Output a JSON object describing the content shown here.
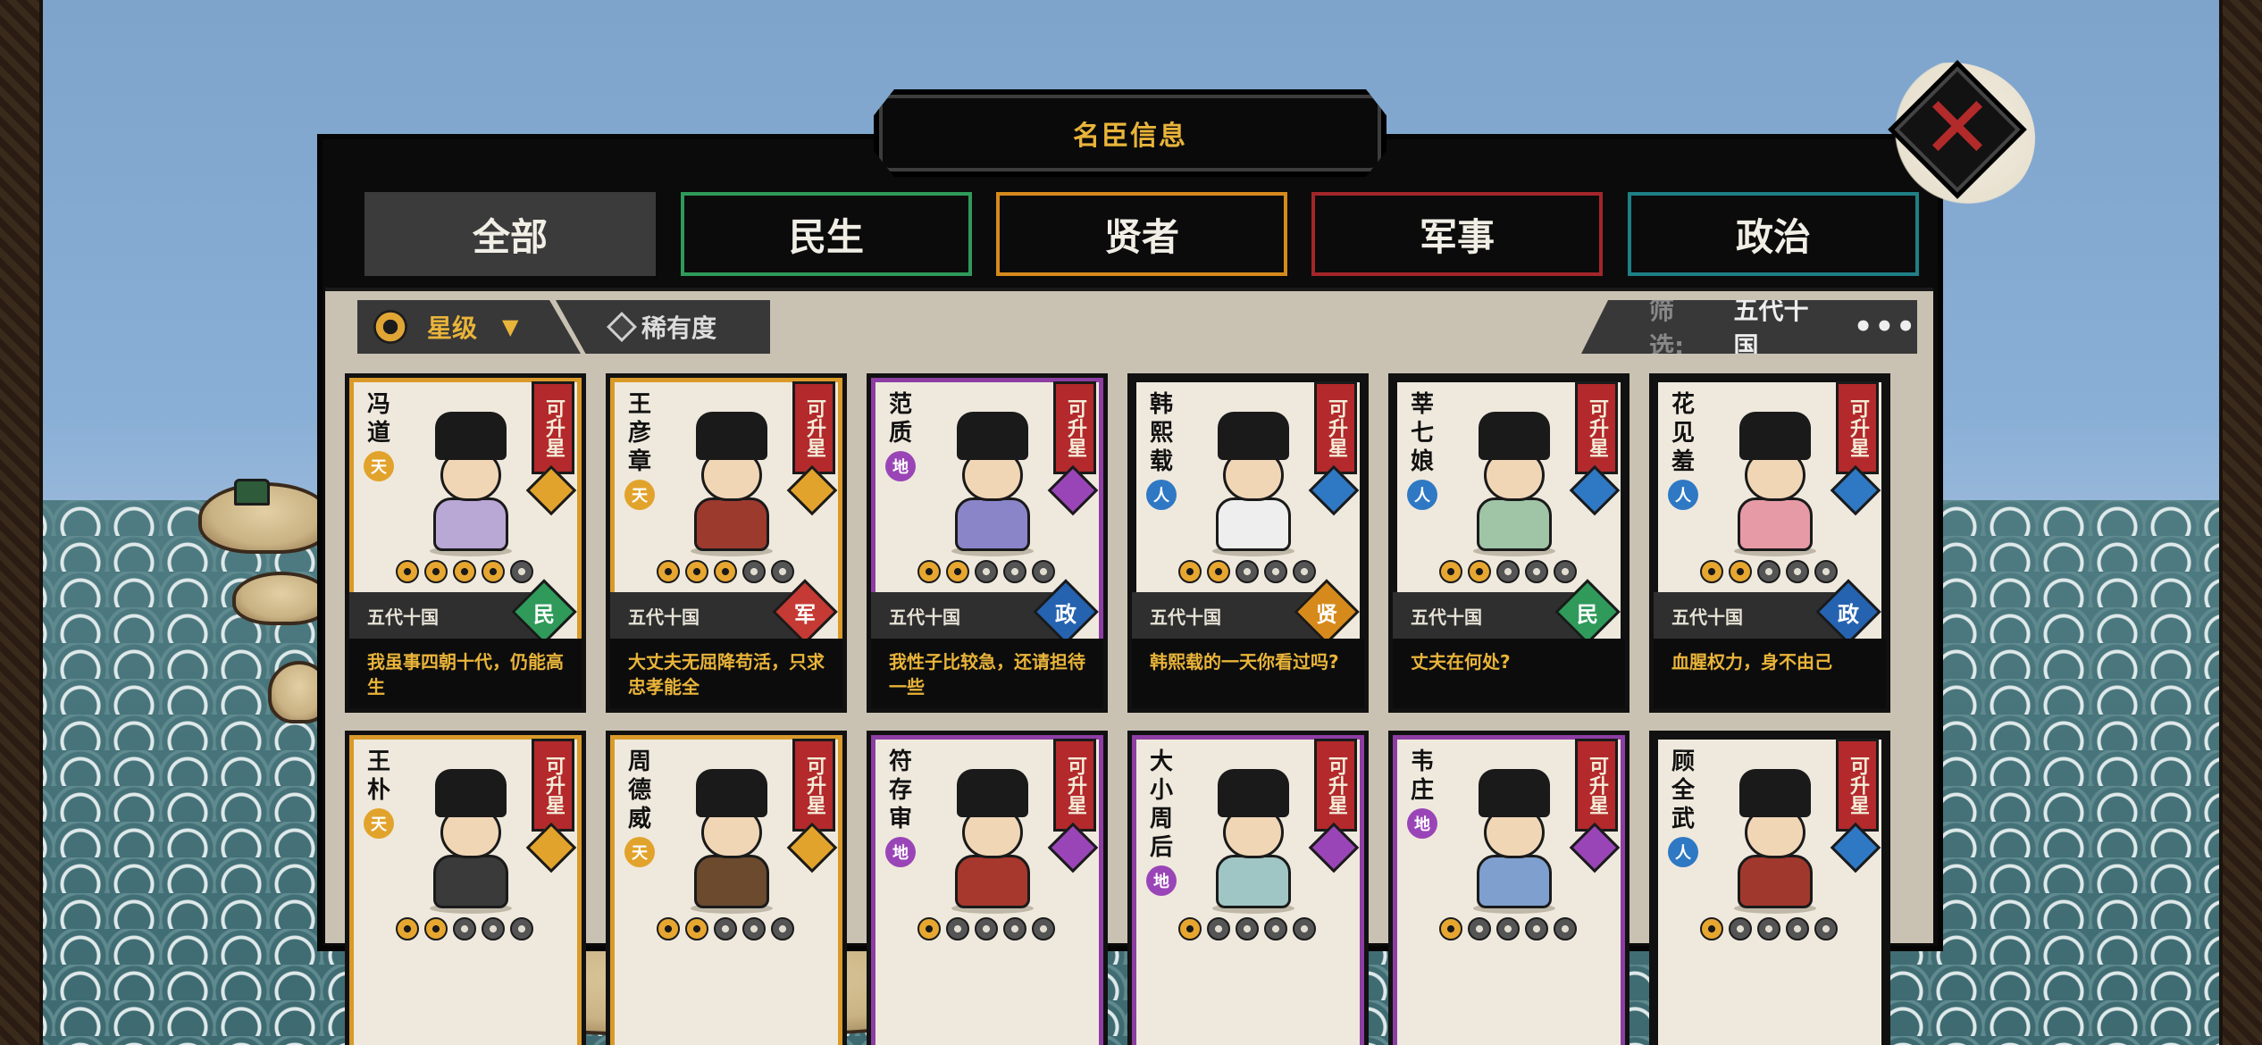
{
  "panel": {
    "title": "名臣信息"
  },
  "tabs": [
    {
      "label": "全部",
      "color": "#3b3b3b"
    },
    {
      "label": "民生",
      "color": "#2f9a5a"
    },
    {
      "label": "贤者",
      "color": "#d68a1c"
    },
    {
      "label": "军事",
      "color": "#a3262a"
    },
    {
      "label": "政治",
      "color": "#1f7f86"
    }
  ],
  "filters": {
    "star_label": "星级",
    "rarity_label": "稀有度",
    "filter_label": "筛选:",
    "filter_value": "五代十国",
    "more": "•••"
  },
  "rank_colors": {
    "天": "#e2a32c",
    "地": "#9a45b7",
    "人": "#2f78c4"
  },
  "type_colors": {
    "民": "#2f9a5a",
    "军": "#c53a34",
    "政": "#2563b0",
    "贤": "#d68a1c"
  },
  "cards": [
    {
      "name": "冯道",
      "rank": "天",
      "frame": "gold",
      "stars": 4,
      "upgrade": "可升星",
      "dynasty": "五代十国",
      "type": "民",
      "quote": "我虽事四朝十代，仍能高生",
      "body_color": "#b9a7d6"
    },
    {
      "name": "王彦章",
      "rank": "天",
      "frame": "gold",
      "stars": 3,
      "upgrade": "可升星",
      "dynasty": "五代十国",
      "type": "军",
      "quote": "大丈夫无屈降苟活，只求忠孝能全",
      "body_color": "#9d3a2e"
    },
    {
      "name": "范质",
      "rank": "地",
      "frame": "purple",
      "stars": 2,
      "upgrade": "可升星",
      "dynasty": "五代十国",
      "type": "政",
      "quote": "我性子比较急，还请担待一些",
      "body_color": "#8a85c9"
    },
    {
      "name": "韩熙载",
      "rank": "人",
      "frame": "blue",
      "stars": 2,
      "upgrade": "可升星",
      "dynasty": "五代十国",
      "type": "贤",
      "quote": "韩熙载的一天你看过吗?",
      "body_color": "#eeeeee"
    },
    {
      "name": "莘七娘",
      "rank": "人",
      "frame": "blue",
      "stars": 2,
      "upgrade": "可升星",
      "dynasty": "五代十国",
      "type": "民",
      "quote": "丈夫在何处?",
      "body_color": "#9fc4a6"
    },
    {
      "name": "花见羞",
      "rank": "人",
      "frame": "blue",
      "stars": 2,
      "upgrade": "可升星",
      "dynasty": "五代十国",
      "type": "政",
      "quote": "血腥权力，身不由己",
      "body_color": "#e69aa6"
    },
    {
      "name": "王朴",
      "rank": "天",
      "frame": "gold",
      "stars": 2,
      "upgrade": "可升星",
      "dynasty": "",
      "type": "",
      "quote": "",
      "body_color": "#3a3a3a"
    },
    {
      "name": "周德威",
      "rank": "天",
      "frame": "gold",
      "stars": 2,
      "upgrade": "可升星",
      "dynasty": "",
      "type": "",
      "quote": "",
      "body_color": "#6b4a2e"
    },
    {
      "name": "符存审",
      "rank": "地",
      "frame": "purple",
      "stars": 1,
      "upgrade": "可升星",
      "dynasty": "",
      "type": "",
      "quote": "",
      "body_color": "#a6382d"
    },
    {
      "name": "大小周后",
      "rank": "地",
      "frame": "purple",
      "stars": 1,
      "upgrade": "可升星",
      "dynasty": "",
      "type": "",
      "quote": "",
      "body_color": "#9fc6c4"
    },
    {
      "name": "韦庄",
      "rank": "地",
      "frame": "purple",
      "stars": 1,
      "upgrade": "可升星",
      "dynasty": "",
      "type": "",
      "quote": "",
      "body_color": "#7f9fcf"
    },
    {
      "name": "顾全武",
      "rank": "人",
      "frame": "blue",
      "stars": 1,
      "upgrade": "可升星",
      "dynasty": "",
      "type": "",
      "quote": "",
      "body_color": "#a0382d"
    }
  ]
}
